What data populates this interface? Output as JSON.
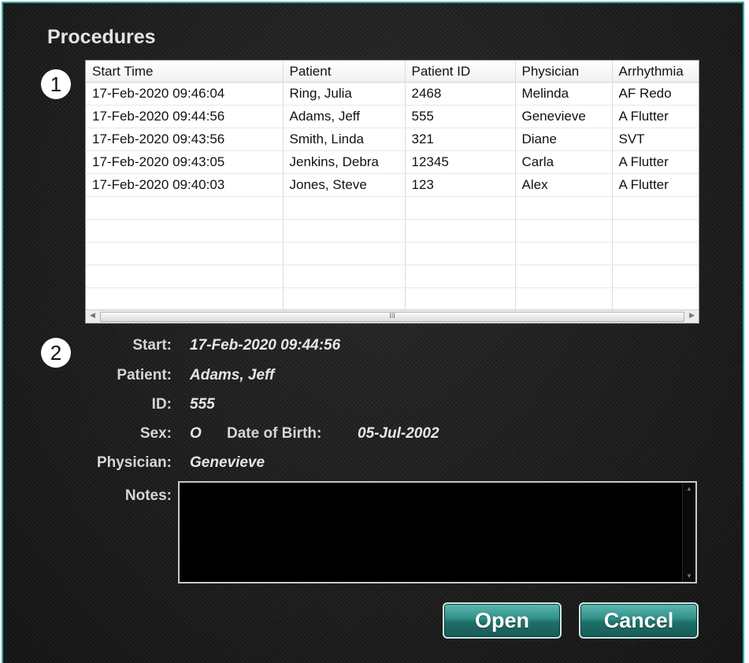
{
  "title": "Procedures",
  "badges": {
    "one": "1",
    "two": "2"
  },
  "table": {
    "columns": [
      "Start Time",
      "Patient",
      "Patient ID",
      "Physician",
      "Arrhythmia"
    ],
    "rows": [
      [
        "17-Feb-2020 09:46:04",
        "Ring, Julia",
        "2468",
        "Melinda",
        "AF Redo"
      ],
      [
        "17-Feb-2020 09:44:56",
        "Adams, Jeff",
        "555",
        "Genevieve",
        "A Flutter"
      ],
      [
        "17-Feb-2020 09:43:56",
        "Smith, Linda",
        "321",
        "Diane",
        "SVT"
      ],
      [
        "17-Feb-2020 09:43:05",
        "Jenkins, Debra",
        "12345",
        "Carla",
        "A Flutter"
      ],
      [
        "17-Feb-2020 09:40:03",
        "Jones, Steve",
        "123",
        "Alex",
        "A Flutter"
      ]
    ],
    "empty_rows": 5,
    "scroll_grip": "III"
  },
  "details": {
    "start_label": "Start:",
    "start_value": "17-Feb-2020 09:44:56",
    "patient_label": "Patient:",
    "patient_value": "Adams, Jeff",
    "id_label": "ID:",
    "id_value": "555",
    "sex_label": "Sex:",
    "sex_value": "O",
    "dob_label": "Date of Birth:",
    "dob_value": "05-Jul-2002",
    "physician_label": "Physician:",
    "physician_value": "Genevieve",
    "notes_label": "Notes:",
    "notes_value": ""
  },
  "buttons": {
    "open": "Open",
    "cancel": "Cancel"
  },
  "colors": {
    "accent": "#2e8f87",
    "frame": "#3aa9a1",
    "background": "#1c1c1c"
  }
}
